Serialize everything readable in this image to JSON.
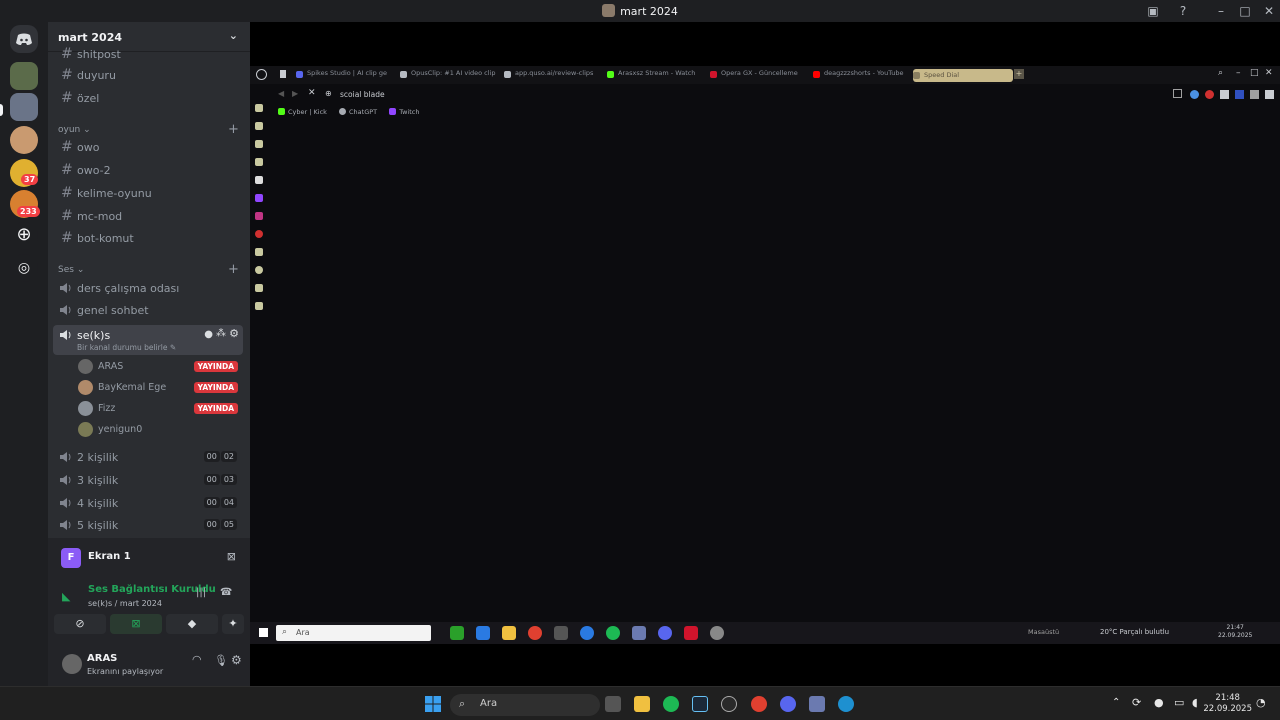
{
  "window": {
    "title": "mart 2024"
  },
  "servers": {
    "badges": [
      "37",
      "233"
    ]
  },
  "guild": {
    "name": "mart 2024",
    "channels_top": [
      {
        "name": "shitpost"
      },
      {
        "name": "duyuru"
      },
      {
        "name": "özel"
      }
    ],
    "category_oyun": "oyun",
    "oyun_channels": [
      "owo",
      "owo-2",
      "kelime-oyunu",
      "mc-mod",
      "bot-komut"
    ],
    "category_ses": "Ses",
    "voice_channels": [
      "ders çalışma odası",
      "genel sohbet"
    ],
    "active_voice": {
      "name": "se(k)s",
      "status_placeholder": "Bir kanal durumu belirle"
    },
    "members": [
      {
        "name": "ARAS",
        "live": "YAYINDA"
      },
      {
        "name": "BayKemal Ege",
        "live": "YAYINDA"
      },
      {
        "name": "Fizz",
        "live": "YAYINDA"
      },
      {
        "name": "yenigun0",
        "live": ""
      }
    ],
    "limited_channels": [
      {
        "name": "2 kişilik",
        "a": "00",
        "b": "02"
      },
      {
        "name": "3 kişilik",
        "a": "00",
        "b": "03"
      },
      {
        "name": "4 kişilik",
        "a": "00",
        "b": "04"
      },
      {
        "name": "5 kişilik",
        "a": "00",
        "b": "05"
      }
    ]
  },
  "panel": {
    "screen_letter": "F",
    "screen_label": "Ekran 1",
    "voice_status": "Ses Bağlantısı Kuruldu",
    "voice_location": "se(k)s / mart 2024",
    "username": "ARAS",
    "user_status": "Ekranını paylaşıyor"
  },
  "browser": {
    "tabs": [
      "Spikes Studio | AI clip ge",
      "OpusClip: #1 AI video clip",
      "app.quso.ai/review-clips",
      "Arasxsz Stream - Watch",
      "Opera GX - Güncelleme",
      "deagzzzshorts - YouTube",
      "Speed Dial"
    ],
    "url": "scoial blade",
    "bookmarks": [
      "Cyber | Kick",
      "ChatGPT",
      "Twitch"
    ],
    "inner_search": "Ara",
    "inner_weather_label": "Masaüstü",
    "inner_weather": "20°C  Parçalı bulutlu",
    "inner_time": "21:47",
    "inner_date": "22.09.2025"
  },
  "taskbar": {
    "search_placeholder": "Ara",
    "time": "21:48",
    "date": "22.09.2025"
  }
}
